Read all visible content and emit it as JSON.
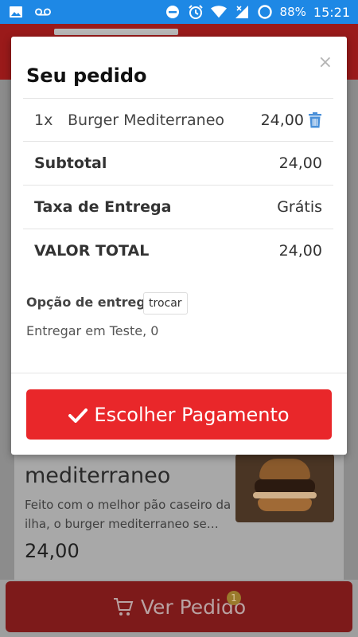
{
  "status_bar": {
    "battery": "88%",
    "time": "15:21",
    "icons": [
      "image-icon",
      "voicemail-icon",
      "do-not-disturb-icon",
      "alarm-icon",
      "wifi-icon",
      "signal-icon",
      "battery-icon"
    ]
  },
  "background": {
    "product_title": "mediterraneo",
    "product_desc": "Feito com o melhor pão caseiro da ilha, o burger mediterraneo se…",
    "product_price": "24,00",
    "view_order_label": "Ver Pedido",
    "badge_count": "1"
  },
  "modal": {
    "title": "Seu pedido",
    "close": "×",
    "item": {
      "qty": "1x",
      "name": "Burger Mediterraneo",
      "price": "24,00"
    },
    "subtotal_label": "Subtotal",
    "subtotal_value": "24,00",
    "fee_label": "Taxa de Entrega",
    "fee_value": "Grátis",
    "total_label": "VALOR TOTAL",
    "total_value": "24,00",
    "delivery_option_label": "Opção de entrega",
    "change_label": "trocar",
    "address": "Entregar em Teste, 0",
    "pay_button_label": "Escolher Pagamento"
  },
  "colors": {
    "status_bar": "#1e88e5",
    "primary_button": "#e9272a",
    "trash_icon": "#4a90d9"
  }
}
